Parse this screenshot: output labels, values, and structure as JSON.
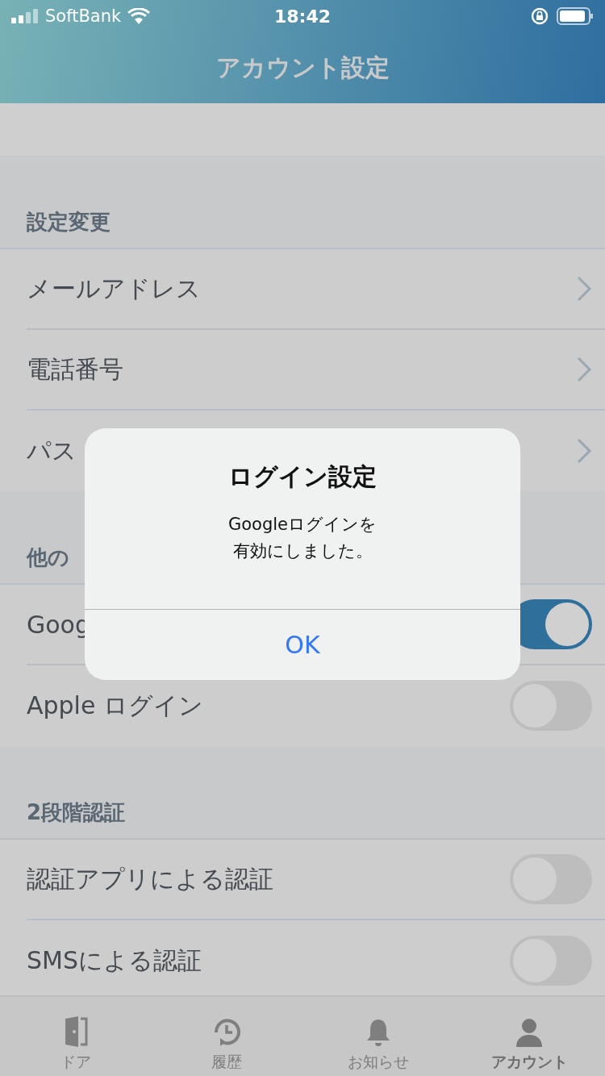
{
  "status_bar": {
    "carrier": "SoftBank",
    "time": "18:42"
  },
  "nav": {
    "title": "アカウント設定"
  },
  "sections": [
    {
      "header": "設定変更",
      "rows": [
        {
          "label": "メールアドレス",
          "kind": "link"
        },
        {
          "label": "電話番号",
          "kind": "link"
        },
        {
          "label": "パス",
          "kind": "link"
        }
      ]
    },
    {
      "header": "他の",
      "rows": [
        {
          "label": "Goog",
          "kind": "toggle",
          "on": true
        },
        {
          "label": "Apple ログイン",
          "kind": "toggle",
          "on": false
        }
      ]
    },
    {
      "header": "2段階認証",
      "rows": [
        {
          "label": "認証アプリによる認証",
          "kind": "toggle",
          "on": false
        },
        {
          "label": "SMSによる認証",
          "kind": "toggle",
          "on": false
        }
      ]
    }
  ],
  "tabs": [
    {
      "label": "ドア",
      "kind": "door",
      "selected": false
    },
    {
      "label": "履歴",
      "kind": "history",
      "selected": false
    },
    {
      "label": "お知らせ",
      "kind": "bell",
      "selected": false
    },
    {
      "label": "アカウント",
      "kind": "person",
      "selected": true
    }
  ],
  "dialog": {
    "title": "ログイン設定",
    "message_lines": [
      "Googleログインを",
      "有効にしました。"
    ],
    "button": "OK"
  }
}
